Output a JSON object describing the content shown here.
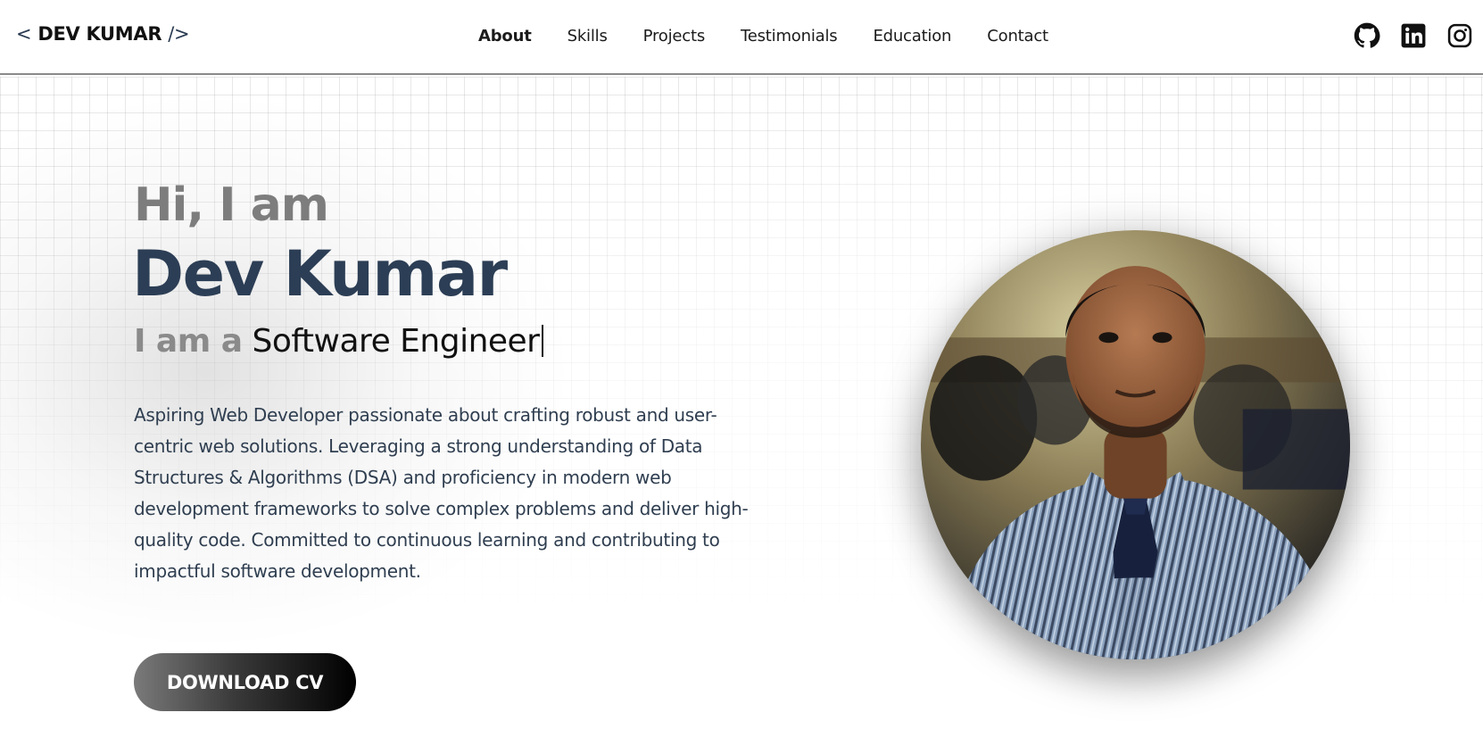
{
  "header": {
    "logo": {
      "open": "<",
      "name": "DEV KUMAR",
      "close": "/>"
    },
    "nav": [
      {
        "label": "About",
        "active": true
      },
      {
        "label": "Skills"
      },
      {
        "label": "Projects"
      },
      {
        "label": "Testimonials"
      },
      {
        "label": "Education"
      },
      {
        "label": "Contact"
      }
    ],
    "socials": [
      {
        "icon": "github-icon"
      },
      {
        "icon": "linkedin-icon"
      },
      {
        "icon": "instagram-icon"
      }
    ]
  },
  "hero": {
    "greeting": "Hi, I am",
    "name": "Dev Kumar",
    "role_prefix": "I am a",
    "role": "Software Engineer",
    "bio": "Aspiring Web Developer passionate about crafting robust and user-centric web solutions. Leveraging a strong understanding of Data Structures & Algorithms (DSA) and proficiency in modern web development frameworks to solve complex problems and deliver high-quality code. Committed to continuous learning and contributing to impactful software development.",
    "cta_label": "DOWNLOAD CV"
  },
  "colors": {
    "name": "#2c3e55",
    "greeting": "#7d7d7d",
    "bio": "#2f3e50",
    "cta_gradient_start": "#7a7a7a",
    "cta_gradient_end": "#000000"
  }
}
